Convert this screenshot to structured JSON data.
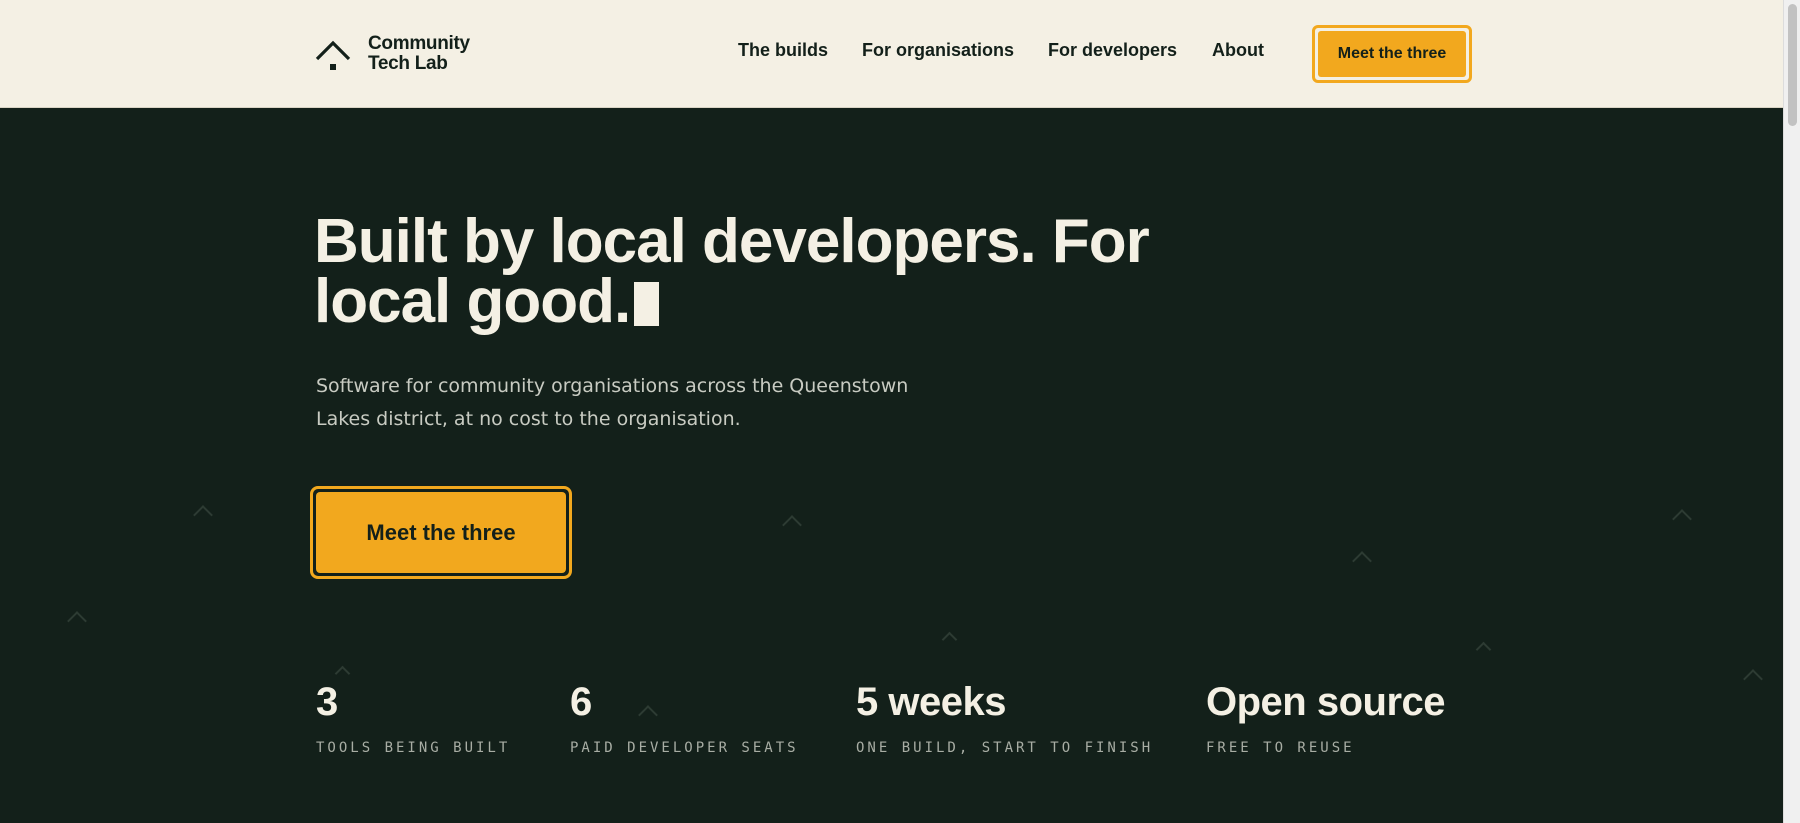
{
  "brand": {
    "name_line1": "Community",
    "name_line2": "Tech Lab",
    "logo_icon": "house-roof-icon"
  },
  "nav": {
    "items": [
      {
        "label": "The builds"
      },
      {
        "label": "For organisations"
      },
      {
        "label": "For developers"
      },
      {
        "label": "About"
      }
    ],
    "cta_label": "Meet the three"
  },
  "hero": {
    "title": "Built by local developers. For local good.",
    "subtitle": "Software for community organisations across the Queenstown Lakes district, at no cost to the organisation.",
    "cta_label": "Meet the three"
  },
  "stats": [
    {
      "value": "3",
      "label": "TOOLS BEING BUILT"
    },
    {
      "value": "6",
      "label": "PAID DEVELOPER SEATS"
    },
    {
      "value": "5 weeks",
      "label": "ONE BUILD, START TO FINISH"
    },
    {
      "value": "Open source",
      "label": "FREE TO REUSE"
    }
  ],
  "colors": {
    "background": "#13201a",
    "header_bg": "#f4f0e4",
    "accent": "#f2a81e",
    "text_light": "#f4f0e4"
  }
}
